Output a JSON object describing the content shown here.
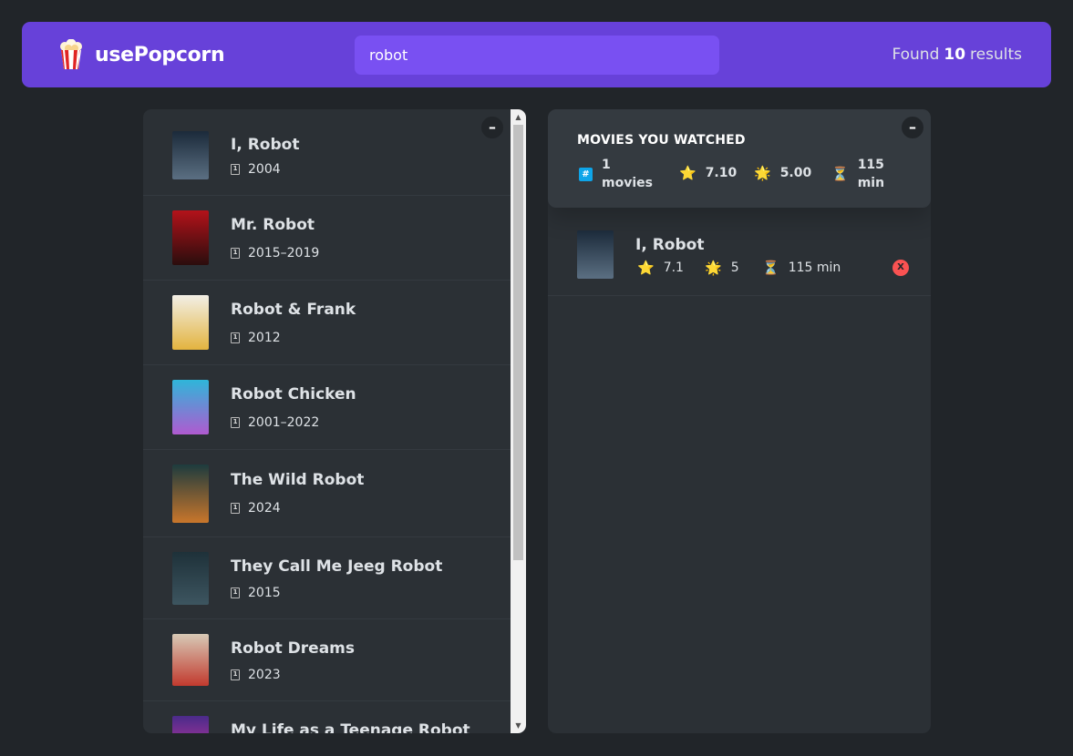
{
  "navbar": {
    "logo_text": "usePopcorn",
    "search_value": "robot",
    "results_prefix": "Found",
    "results_count": "10",
    "results_suffix": "results"
  },
  "movies_list": {
    "toggle_label": "–",
    "items": [
      {
        "title": "I, Robot",
        "year": "2004",
        "poster_colors": [
          "#1b2a3a",
          "#5b6f82"
        ]
      },
      {
        "title": "Mr. Robot",
        "year": "2015–2019",
        "poster_colors": [
          "#b3121a",
          "#2a0d0d"
        ]
      },
      {
        "title": "Robot & Frank",
        "year": "2012",
        "poster_colors": [
          "#f2efe6",
          "#e3b43f"
        ]
      },
      {
        "title": "Robot Chicken",
        "year": "2001–2022",
        "poster_colors": [
          "#2fb6d9",
          "#b05ad0"
        ]
      },
      {
        "title": "The Wild Robot",
        "year": "2024",
        "poster_colors": [
          "#1d3b3e",
          "#c9762b"
        ]
      },
      {
        "title": "They Call Me Jeeg Robot",
        "year": "2015",
        "poster_colors": [
          "#1e3139",
          "#3d5560"
        ]
      },
      {
        "title": "Robot Dreams",
        "year": "2023",
        "poster_colors": [
          "#d7c9b6",
          "#c23a2e"
        ]
      },
      {
        "title": "My Life as a Teenage Robot",
        "year": "",
        "poster_colors": [
          "#4a2b8a",
          "#e43aa3"
        ]
      }
    ]
  },
  "watched_summary": {
    "toggle_label": "–",
    "heading": "MOVIES YOU WATCHED",
    "count_number": "1",
    "count_unit": "movies",
    "avg_imdb_rating": "7.10",
    "avg_user_rating": "5.00",
    "runtime_number": "115",
    "runtime_unit": "min",
    "icons": {
      "count": "#",
      "imdb": "⭐",
      "user": "🌟",
      "time": "⏳"
    }
  },
  "watched_list": [
    {
      "title": "I, Robot",
      "imdb_rating": "7.1",
      "user_rating": "5",
      "runtime": "115 min",
      "delete_label": "X",
      "poster_colors": [
        "#1b2a3a",
        "#5b6f82"
      ]
    }
  ],
  "colors": {
    "background": "#212529",
    "nav": "#6741d9",
    "search": "#7950f2",
    "box": "#2b3035",
    "summary": "#343a40",
    "delete": "#fa5252"
  }
}
